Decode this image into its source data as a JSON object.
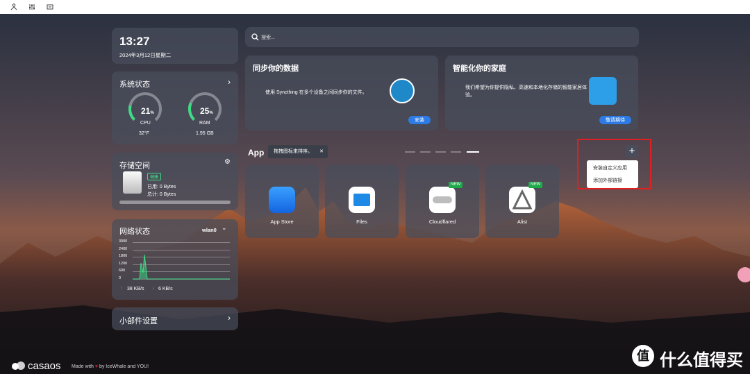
{
  "top_icons": [
    "user-tree-icon",
    "sliders-icon",
    "screen-icon"
  ],
  "clock": {
    "time": "13:27",
    "date": "2024年3月12日星期二"
  },
  "system": {
    "title": "系统状态",
    "cpu_value": "21",
    "cpu_unit": "%",
    "cpu_label": "CPU",
    "cpu_temp": "32°F",
    "cpu_pct": 0.21,
    "ram_value": "25",
    "ram_unit": "%",
    "ram_label": "RAM",
    "ram_size": "1.95 GB",
    "ram_pct": 0.25
  },
  "storage": {
    "title": "存储空间",
    "badge": "健康",
    "used": "已用: 0 Bytes",
    "total": "总计: 0 Bytes"
  },
  "network": {
    "title": "网络状态",
    "iface": "wlan0",
    "y_ticks": [
      "3000",
      "2400",
      "1800",
      "1200",
      "600",
      "0"
    ],
    "up": "38 KB/s",
    "down": "6 KB/s"
  },
  "widgets": {
    "title": "小部件设置"
  },
  "search": {
    "placeholder": "搜索..."
  },
  "banner1": {
    "title": "同步你的数据",
    "text": "使用 Syncthing 在多个设备之间同步你的文件。",
    "button": "安装"
  },
  "banner2": {
    "title": "智能化你的家庭",
    "text": "我们希望为你提供隐私、高速和本地化存储的智能家居体验。",
    "button": "敬请期待"
  },
  "apps_section": {
    "title": "App",
    "tooltip": "拖拽图标来排序。",
    "tooltip_close": "✕",
    "add": "+"
  },
  "apps": [
    {
      "name": "App Store",
      "new": ""
    },
    {
      "name": "Files",
      "new": ""
    },
    {
      "name": "Cloudflared",
      "new": "NEW"
    },
    {
      "name": "Alist",
      "new": "NEW"
    }
  ],
  "menu": {
    "item1": "安装自定义应用",
    "item2": "添加外部链接"
  },
  "footer": {
    "logo": "casaos",
    "made": "Made with",
    "by": "by IceWhale and YOU!"
  },
  "watermark": {
    "text": "什么值得买",
    "symbol": "值"
  },
  "colors": {
    "accent": "#2d7be5",
    "ring_green": "#3ddc84",
    "highlight_red": "#e02020"
  }
}
